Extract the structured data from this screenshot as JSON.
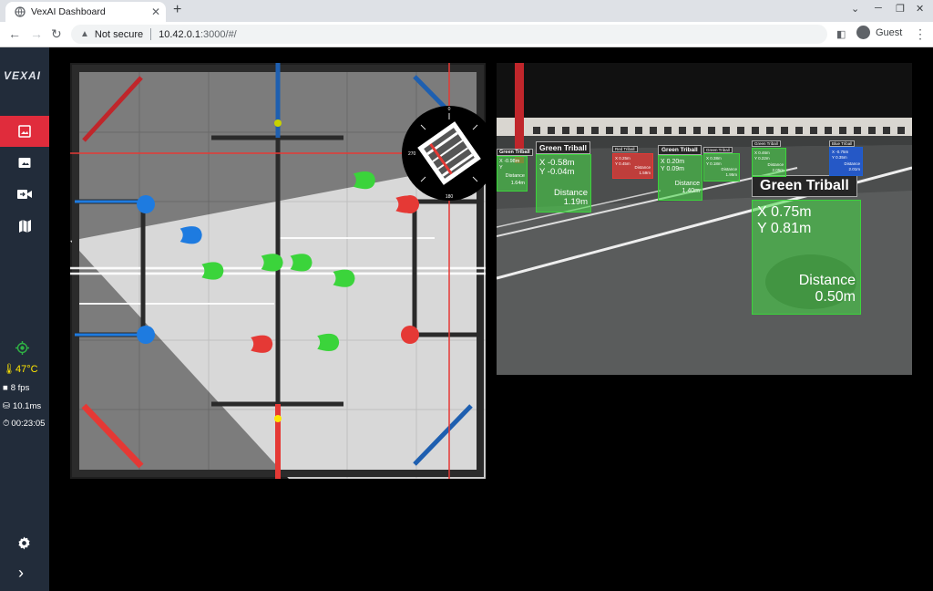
{
  "browser": {
    "tab_title": "VexAI Dashboard",
    "url_warning": "Not secure",
    "url_host": "10.42.0.1",
    "url_path": ":3000/#/",
    "profile": "Guest"
  },
  "sidebar": {
    "logo": "VEXAI",
    "stats": {
      "temperature": "47°C",
      "fps": "8 fps",
      "latency": "10.1ms",
      "uptime": "00:23:05"
    }
  },
  "field": {
    "compass": {
      "n": "0",
      "e": "90",
      "s": "180",
      "w": "270"
    },
    "triballs": [
      {
        "color": "green",
        "fx": 0.708,
        "fy": 0.282
      },
      {
        "color": "blue",
        "fx": 0.291,
        "fy": 0.414
      },
      {
        "color": "green",
        "fx": 0.343,
        "fy": 0.5
      },
      {
        "color": "green",
        "fx": 0.486,
        "fy": 0.48
      },
      {
        "color": "green",
        "fx": 0.556,
        "fy": 0.48
      },
      {
        "color": "green",
        "fx": 0.659,
        "fy": 0.518
      },
      {
        "color": "red",
        "fx": 0.461,
        "fy": 0.676
      },
      {
        "color": "green",
        "fx": 0.621,
        "fy": 0.672
      },
      {
        "color": "red",
        "fx": 0.81,
        "fy": 0.34
      }
    ]
  },
  "camera": {
    "detections": [
      {
        "label": "Green Triball",
        "color": "green",
        "x": "X 0.75m",
        "y": "Y 0.81m",
        "distance_label": "Distance",
        "distance": "0.50m"
      },
      {
        "label": "Green Triball",
        "color": "green",
        "x": "X -0.58m",
        "y": "Y -0.04m",
        "distance_label": "Distance",
        "distance": "1.19m"
      },
      {
        "label": "Green Triball",
        "color": "green",
        "x": "X 0.20m",
        "y": "Y 0.09m",
        "distance_label": "Distance",
        "distance": "1.40m"
      },
      {
        "label": "Green Triball",
        "color": "green",
        "x": "X -0.98m",
        "y": "Y",
        "distance_label": "Distance",
        "distance": "1.64m"
      },
      {
        "label": "Red Triball",
        "color": "red",
        "x": "X 0.25m",
        "y": "Y 0.45m",
        "distance_label": "Distance",
        "distance": "1.59m"
      },
      {
        "label": "Green Triball",
        "color": "green",
        "x": "X 0.38m",
        "y": "Y 0.18m",
        "distance_label": "Distance",
        "distance": "1.95m"
      },
      {
        "label": "Green Triball",
        "color": "green",
        "x": "X 0.46m",
        "y": "Y 0.22m",
        "distance_label": "Distance",
        "distance": "2.05m"
      },
      {
        "label": "Blue Triball",
        "color": "blue",
        "x": "X -0.75m",
        "y": "Y 0.35m",
        "distance_label": "Distance",
        "distance": "2.01m"
      }
    ]
  },
  "colors": {
    "sidebar_bg": "#222c3a",
    "active_nav": "#e02c3c",
    "triball_green": "#3bd43b",
    "triball_red": "#e53935",
    "triball_blue": "#1e7be0"
  }
}
